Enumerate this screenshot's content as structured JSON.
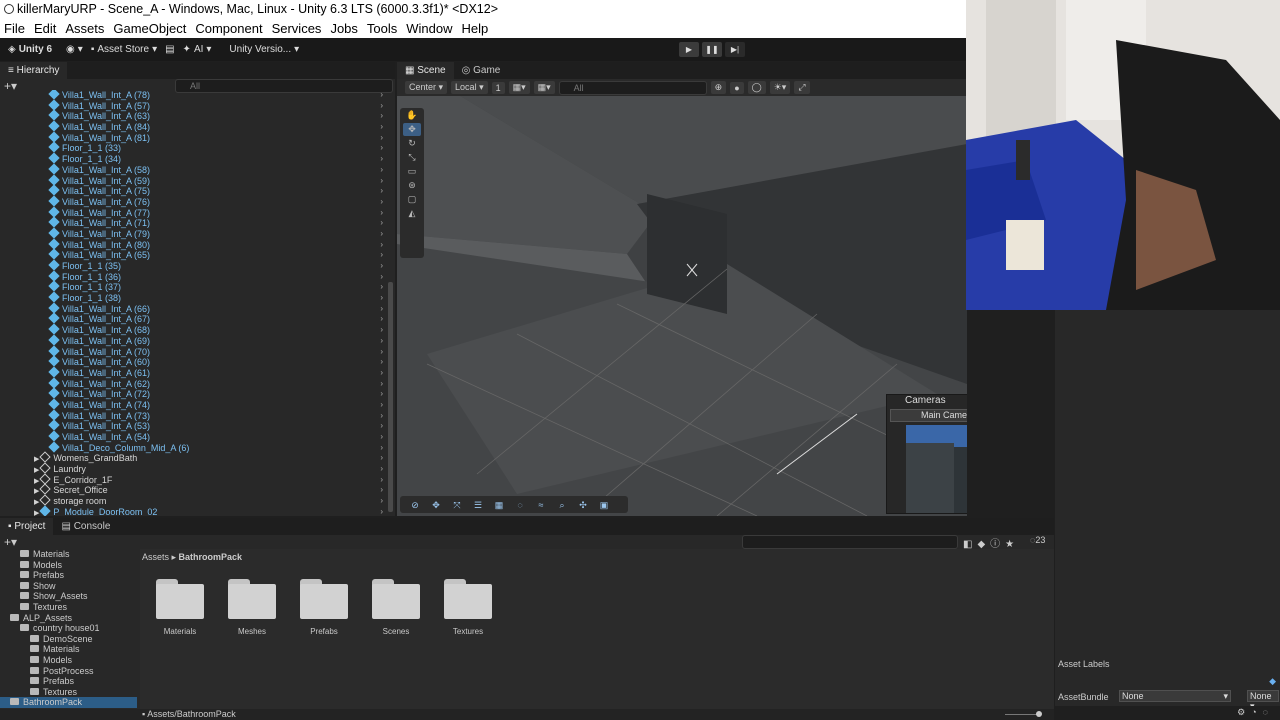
{
  "title": "killerMaryURP - Scene_A - Windows, Mac, Linux - Unity 6.3 LTS (6000.3.3f1)* <DX12>",
  "menu": [
    "File",
    "Edit",
    "Assets",
    "GameObject",
    "Component",
    "Services",
    "Jobs",
    "Tools",
    "Window",
    "Help"
  ],
  "toolbar": {
    "account": "Unity 6",
    "asset_store": "Asset Store",
    "ai": "AI",
    "version": "Unity Versio..."
  },
  "hierarchy": {
    "tab": "Hierarchy",
    "search_placeholder": "All",
    "items": [
      {
        "label": "Villa1_Wall_Int_A (78)",
        "color": "blue"
      },
      {
        "label": "Villa1_Wall_Int_A (57)",
        "color": "blue"
      },
      {
        "label": "Villa1_Wall_Int_A (63)",
        "color": "blue"
      },
      {
        "label": "Villa1_Wall_Int_A (84)",
        "color": "blue"
      },
      {
        "label": "Villa1_Wall_Int_A (81)",
        "color": "blue"
      },
      {
        "label": "Floor_1_1 (33)",
        "color": "blue"
      },
      {
        "label": "Floor_1_1 (34)",
        "color": "blue"
      },
      {
        "label": "Villa1_Wall_Int_A (58)",
        "color": "blue"
      },
      {
        "label": "Villa1_Wall_Int_A (59)",
        "color": "blue"
      },
      {
        "label": "Villa1_Wall_Int_A (75)",
        "color": "blue"
      },
      {
        "label": "Villa1_Wall_Int_A (76)",
        "color": "blue"
      },
      {
        "label": "Villa1_Wall_Int_A (77)",
        "color": "blue"
      },
      {
        "label": "Villa1_Wall_Int_A (71)",
        "color": "blue"
      },
      {
        "label": "Villa1_Wall_Int_A (79)",
        "color": "blue"
      },
      {
        "label": "Villa1_Wall_Int_A (80)",
        "color": "blue"
      },
      {
        "label": "Villa1_Wall_Int_A (65)",
        "color": "blue"
      },
      {
        "label": "Floor_1_1 (35)",
        "color": "blue"
      },
      {
        "label": "Floor_1_1 (36)",
        "color": "blue"
      },
      {
        "label": "Floor_1_1 (37)",
        "color": "blue"
      },
      {
        "label": "Floor_1_1 (38)",
        "color": "blue"
      },
      {
        "label": "Villa1_Wall_Int_A (66)",
        "color": "blue"
      },
      {
        "label": "Villa1_Wall_Int_A (67)",
        "color": "blue"
      },
      {
        "label": "Villa1_Wall_Int_A (68)",
        "color": "blue"
      },
      {
        "label": "Villa1_Wall_Int_A (69)",
        "color": "blue"
      },
      {
        "label": "Villa1_Wall_Int_A (70)",
        "color": "blue"
      },
      {
        "label": "Villa1_Wall_Int_A (60)",
        "color": "blue"
      },
      {
        "label": "Villa1_Wall_Int_A (61)",
        "color": "blue"
      },
      {
        "label": "Villa1_Wall_Int_A (62)",
        "color": "blue"
      },
      {
        "label": "Villa1_Wall_Int_A (72)",
        "color": "blue"
      },
      {
        "label": "Villa1_Wall_Int_A (74)",
        "color": "blue"
      },
      {
        "label": "Villa1_Wall_Int_A (73)",
        "color": "blue"
      },
      {
        "label": "Villa1_Wall_Int_A (53)",
        "color": "blue"
      },
      {
        "label": "Villa1_Wall_Int_A (54)",
        "color": "blue"
      },
      {
        "label": "Villa1_Deco_Column_Mid_A (6)",
        "color": "blue"
      },
      {
        "label": "Womens_GrandBath",
        "color": "white"
      },
      {
        "label": "Laundry",
        "color": "white"
      },
      {
        "label": "E_Corridor_1F",
        "color": "white"
      },
      {
        "label": "Secret_Office",
        "color": "white"
      },
      {
        "label": "storage room",
        "color": "white"
      },
      {
        "label": "P_Module_DoorRoom_02",
        "color": "blue"
      }
    ]
  },
  "scene": {
    "tabs": [
      "Scene",
      "Game"
    ],
    "pivot": "Center",
    "space": "Local",
    "grid_snap": "1",
    "search_placeholder": "All"
  },
  "cameras": {
    "title": "Cameras",
    "selected": "Main Camera"
  },
  "project": {
    "tabs": [
      "Project",
      "Console"
    ],
    "breadcrumb": [
      "Assets",
      "BathroomPack"
    ],
    "count": "23",
    "tree": [
      {
        "label": "Materials",
        "depth": 2
      },
      {
        "label": "Models",
        "depth": 2
      },
      {
        "label": "Prefabs",
        "depth": 2
      },
      {
        "label": "Show",
        "depth": 2
      },
      {
        "label": "Show_Assets",
        "depth": 2
      },
      {
        "label": "Textures",
        "depth": 2
      },
      {
        "label": "ALP_Assets",
        "depth": 1
      },
      {
        "label": "country house01",
        "depth": 2
      },
      {
        "label": "DemoScene",
        "depth": 3
      },
      {
        "label": "Materials",
        "depth": 3
      },
      {
        "label": "Models",
        "depth": 3
      },
      {
        "label": "PostProcess",
        "depth": 3
      },
      {
        "label": "Prefabs",
        "depth": 3
      },
      {
        "label": "Textures",
        "depth": 3
      },
      {
        "label": "BathroomPack",
        "depth": 1
      }
    ],
    "folders": [
      "Materials",
      "Meshes",
      "Prefabs",
      "Scenes",
      "Textures"
    ],
    "footer_path": "Assets/BathroomPack"
  },
  "inspector": {
    "asset_labels": "Asset Labels",
    "asset_bundle": "AssetBundle",
    "bundle_value": "None",
    "variant_value": "None"
  }
}
